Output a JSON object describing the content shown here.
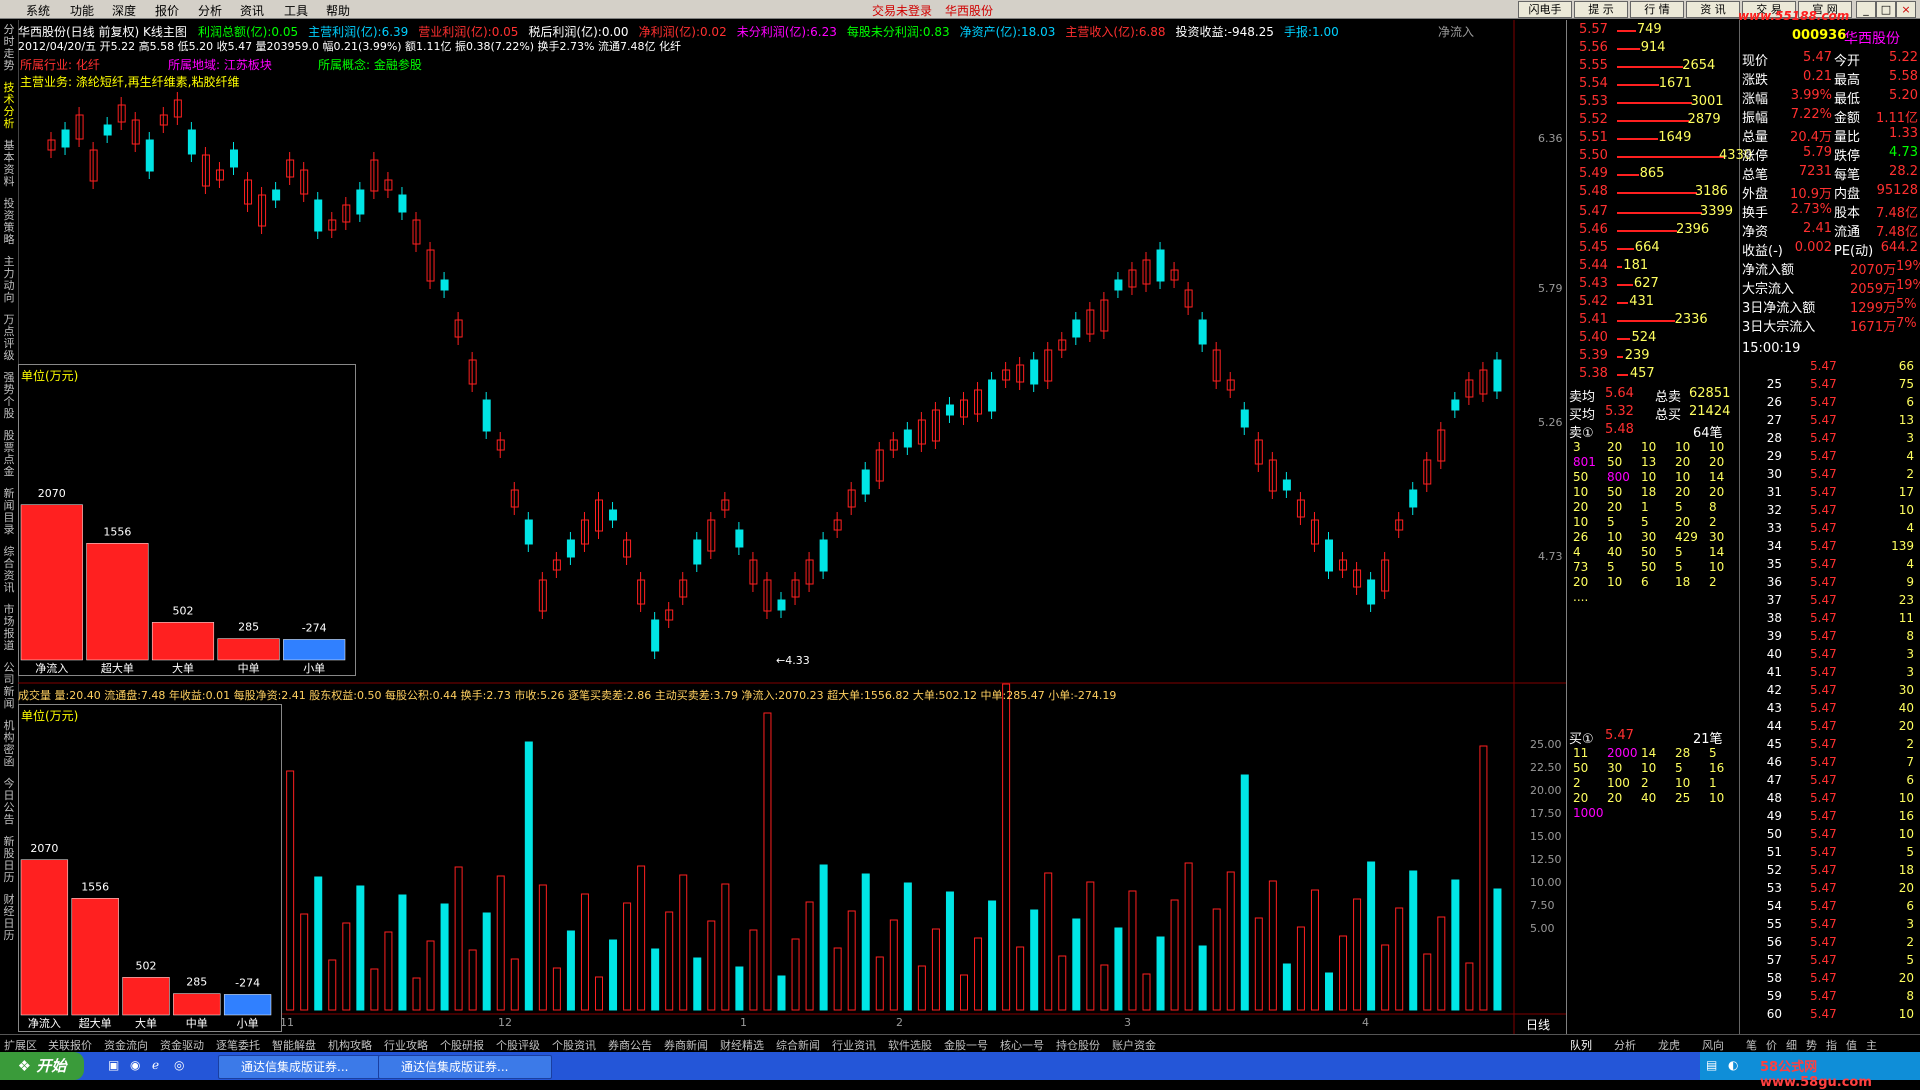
{
  "menu": {
    "items": [
      "系统",
      "功能",
      "深度",
      "报价",
      "分析",
      "资讯",
      "工具",
      "帮助"
    ],
    "center_links": [
      "交易未登录",
      "华西股份"
    ],
    "right_buttons": [
      "闪电手",
      "提 示",
      "行 情",
      "资 讯",
      "交 易",
      "官 网"
    ],
    "watermark": "www.55188.com"
  },
  "left_tabs": [
    {
      "label": "分时走势",
      "active": false
    },
    {
      "label": "技术分析",
      "active": true
    },
    {
      "label": "基本资料",
      "active": false
    },
    {
      "label": "投资策略",
      "active": false
    },
    {
      "label": "主力动向",
      "active": false
    },
    {
      "label": "万点评级",
      "active": false
    },
    {
      "label": "强势个股",
      "active": false
    },
    {
      "label": "股票点金",
      "active": false
    },
    {
      "label": "新闻目录",
      "active": false
    },
    {
      "label": "综合资讯",
      "active": false
    },
    {
      "label": "市场报道",
      "active": false
    },
    {
      "label": "公司新闻",
      "active": false
    },
    {
      "label": "机构密函",
      "active": false
    },
    {
      "label": "今日公告",
      "active": false
    },
    {
      "label": "新股日历",
      "active": false
    },
    {
      "label": "财经日历",
      "active": false
    }
  ],
  "chart_header": {
    "title": "华西股份(日线 前复权) K线主图",
    "metrics": [
      {
        "label": "利润总额(亿)",
        "value": "0.05",
        "color": "#00ff00"
      },
      {
        "label": "主营利润(亿)",
        "value": "6.39",
        "color": "#00d0ff"
      },
      {
        "label": "营业利润(亿)",
        "value": "0.05",
        "color": "#ff3030"
      },
      {
        "label": "税后利润(亿)",
        "value": "0.00",
        "color": "#ffffff"
      },
      {
        "label": "净利润(亿)",
        "value": "0.02",
        "color": "#ff3030"
      },
      {
        "label": "未分利润(亿)",
        "value": "6.23",
        "color": "#ff00ff"
      },
      {
        "label": "每股未分利润",
        "value": "0.83",
        "color": "#00ff00"
      },
      {
        "label": "净资产(亿)",
        "value": "18.03",
        "color": "#00d0ff"
      },
      {
        "label": "主营收入(亿)",
        "value": "6.88",
        "color": "#ff3030"
      },
      {
        "label": "投资收益",
        "value": "-948.25",
        "color": "#ffffff"
      },
      {
        "label": "手报",
        "value": "1.00",
        "color": "#00d0ff"
      }
    ],
    "right_label": "净流入",
    "ohlc_line": "2012/04/20/五 开5.22 高5.58 低5.20 收5.47 量203959.0 幅0.21(3.99%) 额1.11亿 振0.38(7.22%) 换手2.73% 流通7.48亿 化纤",
    "industry_label": "所属行业: 化纤",
    "region_label": "所属地域: 江苏板块",
    "concept_label": "所属概念: 金融参股",
    "business_label": "主营业务: 涤纶短纤,再生纤维素,粘胶纤维"
  },
  "y_axis_price": [
    "6.36",
    "5.79",
    "5.26",
    "4.73"
  ],
  "low_marker": "4.33",
  "volume_header": "成交量  量:20.40 流通盘:7.48 年收益:0.01 每股净资:2.41 股东权益:0.50 每股公积:0.44 换手:2.73 市收:5.26 逐笔买卖差:2.86 主动买卖差:3.79 净流入:2070.23 超大单:1556.82 大单:502.12 中单:285.47 小单:-274.19",
  "y_axis_volume": [
    "25.00",
    "22.50",
    "20.00",
    "17.50",
    "15.00",
    "12.50",
    "10.00",
    "7.50",
    "5.00"
  ],
  "x_axis_labels": [
    "2011年",
    "10",
    "11",
    "12",
    "1",
    "2",
    "3",
    "4"
  ],
  "period_label": "日线",
  "flow_box": {
    "unit": "单位(万元)",
    "bars": [
      {
        "label": "净流入",
        "value": 2070,
        "color": "#ff2020"
      },
      {
        "label": "超大单",
        "value": 1556,
        "color": "#ff2020"
      },
      {
        "label": "大单",
        "value": 502,
        "color": "#ff2020"
      },
      {
        "label": "中单",
        "value": 285,
        "color": "#ff2020"
      },
      {
        "label": "小单",
        "value": -274,
        "color": "#3080ff"
      }
    ]
  },
  "order_book": {
    "sell": [
      {
        "price": "5.57",
        "vol": "749"
      },
      {
        "price": "5.56",
        "vol": "914"
      },
      {
        "price": "5.55",
        "vol": "2654"
      },
      {
        "price": "5.54",
        "vol": "1671"
      },
      {
        "price": "5.53",
        "vol": "3001"
      },
      {
        "price": "5.52",
        "vol": "2879"
      },
      {
        "price": "5.51",
        "vol": "1649"
      },
      {
        "price": "5.50",
        "vol": "4330"
      },
      {
        "price": "5.49",
        "vol": "865"
      },
      {
        "price": "5.48",
        "vol": "3186"
      }
    ],
    "buy": [
      {
        "price": "5.47",
        "vol": "3399"
      },
      {
        "price": "5.46",
        "vol": "2396"
      },
      {
        "price": "5.45",
        "vol": "664"
      },
      {
        "price": "5.44",
        "vol": "181"
      },
      {
        "price": "5.43",
        "vol": "627"
      },
      {
        "price": "5.42",
        "vol": "431"
      },
      {
        "price": "5.41",
        "vol": "2336"
      },
      {
        "price": "5.40",
        "vol": "524"
      },
      {
        "price": "5.39",
        "vol": "239"
      },
      {
        "price": "5.38",
        "vol": "457"
      }
    ],
    "sell_avg_label": "卖均",
    "sell_avg": "5.64",
    "total_sell_label": "总卖",
    "total_sell": "62851",
    "buy_avg_label": "买均",
    "buy_avg": "5.32",
    "total_buy_label": "总买",
    "total_buy": "21424",
    "sell1_label": "卖①",
    "sell1_price": "5.48",
    "sell1_count": "64笔",
    "sell1_queue": [
      [
        "3",
        "20",
        "10",
        "10",
        "10"
      ],
      [
        "801",
        "50",
        "13",
        "20",
        "20"
      ],
      [
        "50",
        "800",
        "10",
        "10",
        "14"
      ],
      [
        "10",
        "50",
        "18",
        "20",
        "20"
      ],
      [
        "20",
        "20",
        "1",
        "5",
        "8"
      ],
      [
        "10",
        "5",
        "5",
        "20",
        "2"
      ],
      [
        "26",
        "10",
        "30",
        "429",
        "30"
      ],
      [
        "4",
        "40",
        "50",
        "5",
        "14"
      ],
      [
        "73",
        "5",
        "50",
        "5",
        "10"
      ],
      [
        "20",
        "10",
        "6",
        "18",
        "2"
      ],
      [
        "....",
        "",
        "",
        "",
        ""
      ]
    ],
    "buy1_label": "买①",
    "buy1_price": "5.47",
    "buy1_count": "21笔",
    "buy1_queue": [
      [
        "11",
        "2000",
        "14",
        "28",
        "5"
      ],
      [
        "50",
        "30",
        "10",
        "5",
        "16"
      ],
      [
        "2",
        "100",
        "2",
        "10",
        "1"
      ],
      [
        "20",
        "20",
        "40",
        "25",
        "10"
      ],
      [
        "1000",
        "",
        "",
        "",
        ""
      ]
    ]
  },
  "quote": {
    "code": "000936",
    "name": "华西股份",
    "rows": [
      [
        "现价",
        "5.47",
        "今开",
        "5.22"
      ],
      [
        "涨跌",
        "0.21",
        "最高",
        "5.58"
      ],
      [
        "涨幅",
        "3.99%",
        "最低",
        "5.20"
      ],
      [
        "振幅",
        "7.22%",
        "金额",
        "1.11亿"
      ],
      [
        "总量",
        "20.4万",
        "量比",
        "1.33"
      ],
      [
        "涨停",
        "5.79",
        "跌停",
        "4.73"
      ],
      [
        "总笔",
        "7231",
        "每笔",
        "28.2"
      ],
      [
        "外盘",
        "10.9万",
        "内盘",
        "95128"
      ],
      [
        "换手",
        "2.73%",
        "股本",
        "7.48亿"
      ],
      [
        "净资",
        "2.41",
        "流通",
        "7.48亿"
      ],
      [
        "收益(-)",
        "0.002",
        "PE(动)",
        "644.2"
      ]
    ],
    "flow_rows": [
      [
        "净流入额",
        "2070万",
        "19%"
      ],
      [
        "大宗流入",
        "2059万",
        "19%"
      ],
      [
        "3日净流入额",
        "1299万",
        "5%"
      ],
      [
        "3日大宗流入",
        "1671万",
        "7%"
      ]
    ]
  },
  "ticks": {
    "time": "15:00:19",
    "rows": [
      [
        "",
        "5.47",
        "66"
      ],
      [
        "25",
        "5.47",
        "75"
      ],
      [
        "26",
        "5.47",
        "6"
      ],
      [
        "27",
        "5.47",
        "13"
      ],
      [
        "28",
        "5.47",
        "3"
      ],
      [
        "29",
        "5.47",
        "4"
      ],
      [
        "30",
        "5.47",
        "2"
      ],
      [
        "31",
        "5.47",
        "17"
      ],
      [
        "32",
        "5.47",
        "10"
      ],
      [
        "33",
        "5.47",
        "4"
      ],
      [
        "34",
        "5.47",
        "139"
      ],
      [
        "35",
        "5.47",
        "4"
      ],
      [
        "36",
        "5.47",
        "9"
      ],
      [
        "37",
        "5.47",
        "23"
      ],
      [
        "38",
        "5.47",
        "11"
      ],
      [
        "39",
        "5.47",
        "8"
      ],
      [
        "40",
        "5.47",
        "3"
      ],
      [
        "41",
        "5.47",
        "3"
      ],
      [
        "42",
        "5.47",
        "30"
      ],
      [
        "43",
        "5.47",
        "40"
      ],
      [
        "44",
        "5.47",
        "20"
      ],
      [
        "45",
        "5.47",
        "2"
      ],
      [
        "46",
        "5.47",
        "7"
      ],
      [
        "47",
        "5.47",
        "6"
      ],
      [
        "48",
        "5.47",
        "10"
      ],
      [
        "49",
        "5.47",
        "16"
      ],
      [
        "50",
        "5.47",
        "10"
      ],
      [
        "51",
        "5.47",
        "5"
      ],
      [
        "52",
        "5.47",
        "18"
      ],
      [
        "53",
        "5.47",
        "20"
      ],
      [
        "54",
        "5.47",
        "6"
      ],
      [
        "55",
        "5.47",
        "3"
      ],
      [
        "56",
        "5.47",
        "2"
      ],
      [
        "57",
        "5.47",
        "5"
      ],
      [
        "58",
        "5.47",
        "20"
      ],
      [
        "59",
        "5.47",
        "8"
      ],
      [
        "60",
        "5.47",
        "10"
      ]
    ]
  },
  "bottom_tabs": [
    "扩展区",
    "关联报价",
    "资金流向",
    "资金驱动",
    "逐笔委托",
    "智能解盘",
    "机构攻略",
    "行业攻略",
    "个股研报",
    "个股评级",
    "个股资讯",
    "券商公告",
    "券商新闻",
    "财经精选",
    "综合新闻",
    "行业资讯",
    "软件选股",
    "金股一号",
    "核心一号",
    "持仓股份",
    "账户资金"
  ],
  "right_bottom_tabs": [
    "队列",
    "分析",
    "龙虎",
    "风向",
    "笔",
    "价",
    "细",
    "势",
    "指",
    "值",
    "主"
  ],
  "taskbar": {
    "start": "开始",
    "tasks": [
      "通达信集成版证券...",
      "通达信集成版证券..."
    ],
    "watermark": "58公式网 www.58gu.com"
  }
}
